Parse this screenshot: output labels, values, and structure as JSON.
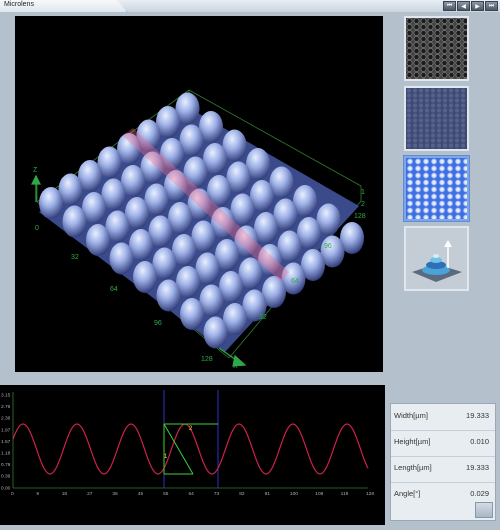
{
  "window": {
    "title": "Microlens"
  },
  "window_buttons": [
    "⏮",
    "◀",
    "▶",
    "⏭"
  ],
  "view3d": {
    "axes": {
      "z": "Z",
      "x": "X",
      "y": "Y"
    },
    "x_ticks": [
      "0",
      "32",
      "64",
      "96",
      "128"
    ],
    "y_ticks": [
      "32",
      "64",
      "96",
      "128"
    ],
    "z_ticks": [
      "0",
      "1",
      "2"
    ]
  },
  "thumbnails": [
    {
      "name": "sem-image",
      "selected": false
    },
    {
      "name": "optical-image",
      "selected": false
    },
    {
      "name": "height-map",
      "selected": true
    },
    {
      "name": "3d-view",
      "selected": false
    }
  ],
  "profile": {
    "y_ticks": [
      "3.15",
      "2.76",
      "2.36",
      "1.97",
      "1.57",
      "1.18",
      "0.79",
      "0.39",
      "0.00"
    ],
    "x_ticks": [
      "0",
      "9",
      "18",
      "27",
      "36",
      "45",
      "55",
      "64",
      "73",
      "82",
      "91",
      "100",
      "109",
      "119",
      "128"
    ],
    "markers": [
      "1",
      "2"
    ]
  },
  "measurements": {
    "width": {
      "label": "Width[µm]",
      "value": "19.333"
    },
    "height": {
      "label": "Height[µm]",
      "value": "0.010"
    },
    "length": {
      "label": "Length[µm]",
      "value": "19.333"
    },
    "angle": {
      "label": "Angle[°]",
      "value": "0.029"
    }
  },
  "colors": {
    "accent_selected": "#5f8bd8",
    "profile_curve": "#cc2244",
    "cursor": "#2c35c8",
    "grid": "#2f7d2f"
  }
}
